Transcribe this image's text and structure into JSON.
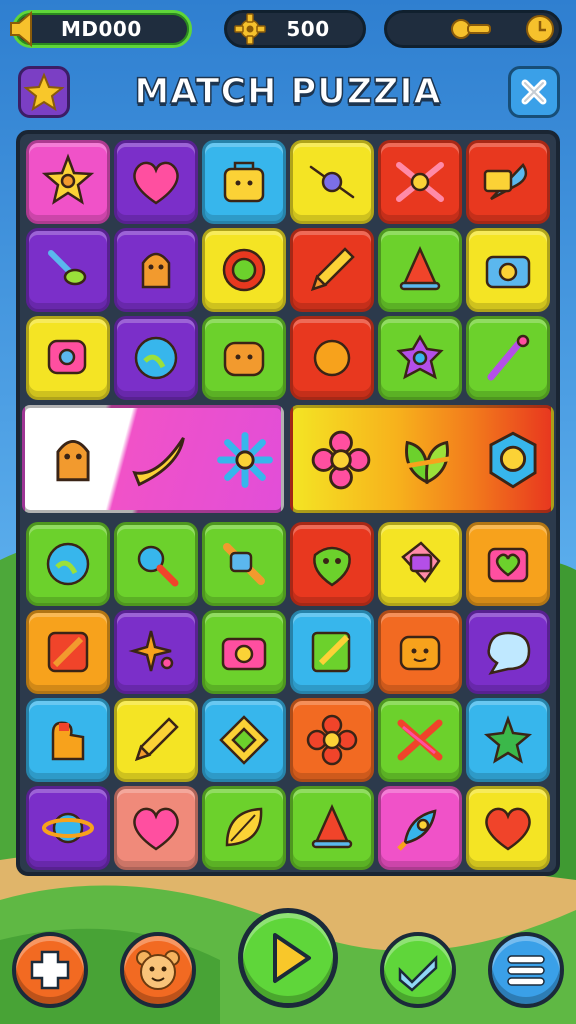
{
  "hud": {
    "coins_value": "MD000",
    "gear_value": "500"
  },
  "title": "MATCH PUZZIA",
  "colors": {
    "sky": "#3d8fd9",
    "board": "#2c3a4c",
    "accent_green": "#5fd63a",
    "title_stroke": "#1d3550"
  },
  "board": {
    "rows": [
      [
        "star",
        "heart",
        "bag",
        "gem-bow",
        "bow",
        "feather"
      ],
      [
        "bird",
        "bear",
        "ring",
        "pencil",
        "cone",
        "camera"
      ],
      [
        "gear-pad",
        "globe",
        "bear-face",
        "sun-orb",
        "donut",
        "brush"
      ],
      [
        "hedgehog",
        "banana",
        "flower-dot",
        "flower",
        "leaf",
        "badge"
      ],
      [
        "globe",
        "magnifier",
        "pipe",
        "alien",
        "tag",
        "heart-box"
      ],
      [
        "frame",
        "sparkle",
        "camera-pink",
        "notepad",
        "face-box",
        "bubble"
      ],
      [
        "duck",
        "pencil-yellow",
        "diamond",
        "flower-red",
        "cross",
        "star-leaf"
      ],
      [
        "planet",
        "heart",
        "leaf-yellow",
        "cone",
        "rocket",
        "heart-red"
      ]
    ]
  },
  "bottom_bar": {
    "buttons": [
      "plus",
      "bear",
      "play",
      "check",
      "menu"
    ]
  }
}
